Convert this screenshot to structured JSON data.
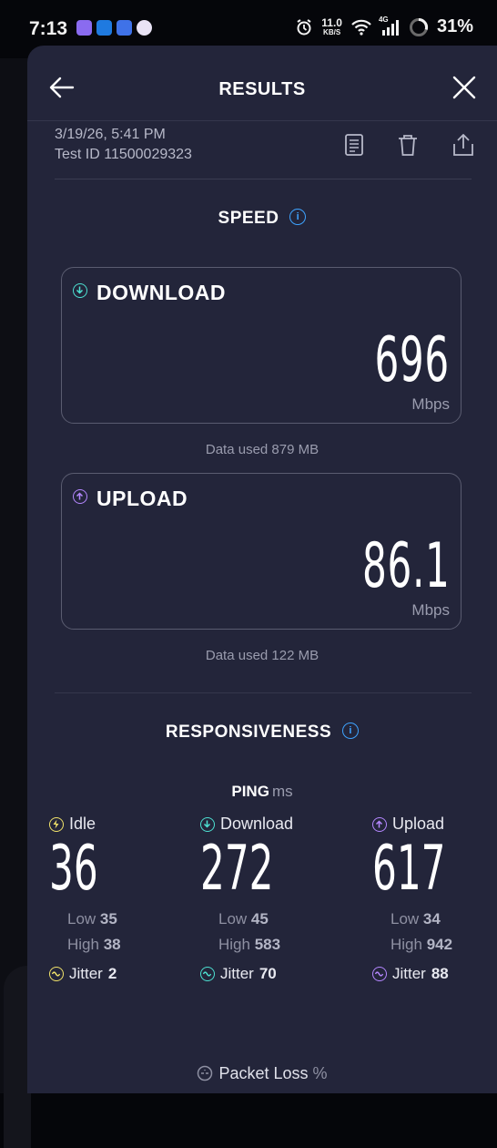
{
  "status_bar": {
    "time": "7:13",
    "net_speed_value": "11.0",
    "net_speed_unit": "KB/S",
    "network": "4G",
    "battery": "31%"
  },
  "header": {
    "title": "RESULTS"
  },
  "meta": {
    "date": "3/19/26, 5:41 PM",
    "test_id": "Test ID 11500029323"
  },
  "speed": {
    "title": "SPEED",
    "download": {
      "label": "DOWNLOAD",
      "value": "696",
      "unit": "Mbps",
      "data_used": "Data used 879 MB",
      "color": "#4de1d2"
    },
    "upload": {
      "label": "UPLOAD",
      "value": "86.1",
      "unit": "Mbps",
      "data_used": "Data used 122 MB",
      "color": "#b487ff"
    }
  },
  "responsiveness": {
    "title": "RESPONSIVENESS",
    "ping_label": "PING",
    "ping_unit": "ms",
    "idle": {
      "label": "Idle",
      "value": "36",
      "low_label": "Low",
      "low": "35",
      "high_label": "High",
      "high": "38",
      "jitter_label": "Jitter",
      "jitter": "2",
      "color": "#f2e36a"
    },
    "download": {
      "label": "Download",
      "value": "272",
      "low_label": "Low",
      "low": "45",
      "high_label": "High",
      "high": "583",
      "jitter_label": "Jitter",
      "jitter": "70",
      "color": "#4de1d2"
    },
    "upload": {
      "label": "Upload",
      "value": "617",
      "low_label": "Low",
      "low": "34",
      "high_label": "High",
      "high": "942",
      "jitter_label": "Jitter",
      "jitter": "88",
      "color": "#b487ff"
    },
    "packet_loss_label": "Packet Loss",
    "packet_loss_unit": "%"
  },
  "icons": {
    "back": "arrow-left-icon",
    "close": "close-icon",
    "notes": "document-icon",
    "delete": "trash-icon",
    "share": "share-icon",
    "info": "info-icon"
  }
}
